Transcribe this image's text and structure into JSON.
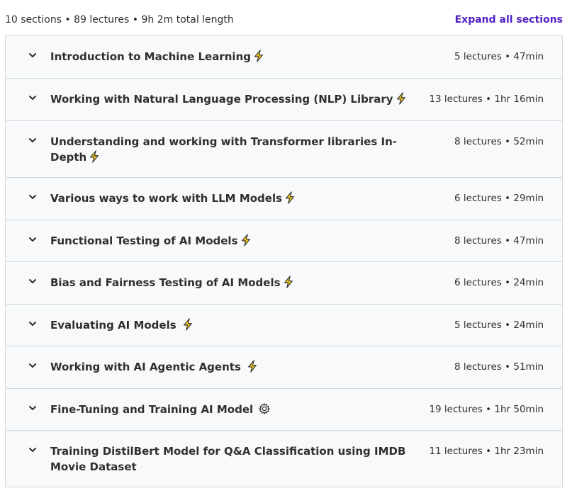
{
  "summary": {
    "text": "10 sections • 89 lectures • 9h 2m total length",
    "expand_label": "Expand all sections"
  },
  "colors": {
    "accent": "#5022c3",
    "row_bg": "#f7f9fa",
    "border": "#d1d7dc",
    "text": "#2d2f31",
    "bolt": "#f5c518"
  },
  "sections": [
    {
      "title": "Introduction to Machine Learning",
      "icon": "lightning-icon",
      "meta": "5 lectures • 47min"
    },
    {
      "title": "Working with Natural Language Processing (NLP) Library",
      "icon": "lightning-icon",
      "meta": "13 lectures • 1hr 16min"
    },
    {
      "title": "Understanding and working with Transformer libraries In-Depth",
      "icon": "lightning-icon",
      "meta": "8 lectures • 52min"
    },
    {
      "title": "Various ways to work with LLM Models",
      "icon": "lightning-icon",
      "meta": "6 lectures • 29min"
    },
    {
      "title": "Functional Testing of AI Models",
      "icon": "lightning-icon",
      "meta": "8 lectures • 47min"
    },
    {
      "title": "Bias and Fairness Testing of AI Models",
      "icon": "lightning-icon",
      "meta": "6 lectures • 24min"
    },
    {
      "title": "Evaluating AI Models ",
      "icon": "lightning-icon",
      "meta": "5 lectures • 24min"
    },
    {
      "title": "Working with AI Agentic Agents ",
      "icon": "lightning-icon",
      "meta": "8 lectures • 51min"
    },
    {
      "title": "Fine-Tuning and Training AI Model ",
      "icon": "gear-icon",
      "meta": "19 lectures • 1hr 50min"
    },
    {
      "title": "Training DistilBert Model for Q&A Classification using IMDB Movie Dataset",
      "icon": "",
      "meta": "11 lectures • 1hr 23min"
    }
  ]
}
